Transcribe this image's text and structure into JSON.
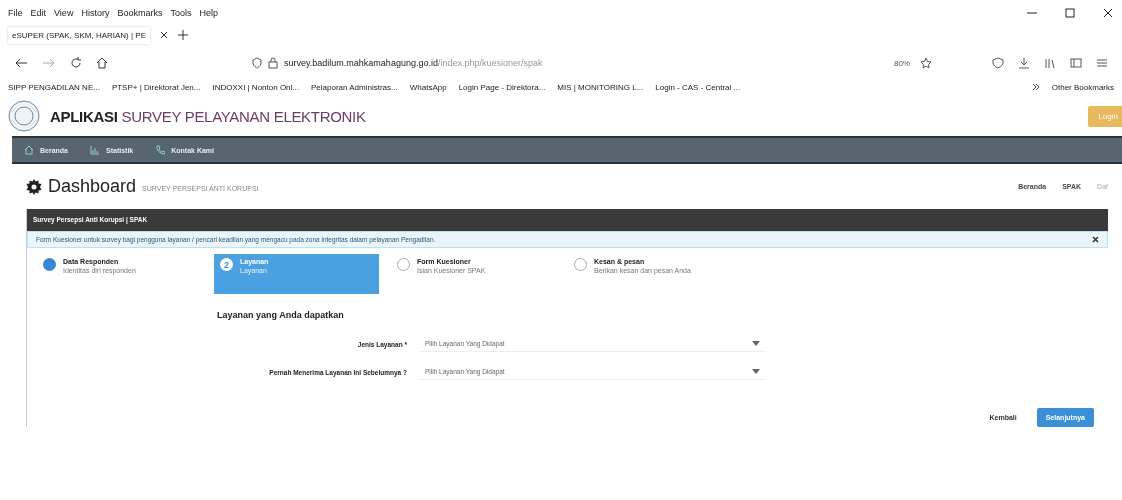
{
  "browser": {
    "menu": [
      "File",
      "Edit",
      "View",
      "History",
      "Bookmarks",
      "Tools",
      "Help"
    ],
    "tabs": [
      {
        "label": "eSUPER (SPAK, SKM, HARIAN) | PE",
        "selected": true
      }
    ],
    "url": {
      "host": "survey.badilum.mahkamahagung.go.id",
      "path": "/index.php/kuesioner/spak"
    },
    "zoom": "80%",
    "bookmarks": [
      "SIPP PENGADILAN NE...",
      "PTSP+ | Direktorat Jen...",
      "INDOXXI | Nonton Onl...",
      "Pelaporan Administras...",
      "WhatsApp",
      "Login Page - Direktora...",
      "MIS | MONITORING L...",
      "Login - CAS - Central ..."
    ],
    "other_bookmarks": "Other Bookmarks"
  },
  "header": {
    "title_bold": "APLIKASI",
    "title": "SURVEY PELAYANAN ELEKTRONIK",
    "login": "Login"
  },
  "nav": [
    {
      "label": "Beranda",
      "kind": "home"
    },
    {
      "label": "Statistik",
      "kind": "chart"
    },
    {
      "label": "Kontak Kami",
      "kind": "phone"
    }
  ],
  "page": {
    "title": "Dashboard",
    "subtitle": "SURVEY PERSEPSI ANTI KORUPSI",
    "breadcrumb": [
      "Beranda",
      "SPAK",
      "Daf"
    ]
  },
  "panel": {
    "title": "Survey Persepsi Anti Korupsi | SPAK",
    "alert": "Form Kuesioner untuk survey bagi pengguna layanan / pencari keadilan yang mengacu pada zona integritas dalam pelayanan Pengadilan.",
    "steps": [
      {
        "title": "Data Responden",
        "sub": "Identitas diri responden",
        "done": true,
        "selected": false
      },
      {
        "title": "Layanan",
        "sub": "Layanan",
        "done": false,
        "selected": true,
        "number": "2"
      },
      {
        "title": "Form Kuesioner",
        "sub": "Isian Kuesioner SPAK",
        "done": false,
        "selected": false
      },
      {
        "title": "Kesan & pesan",
        "sub": "Berikan kesan dan pesan Anda",
        "done": false,
        "selected": false
      }
    ],
    "section": "Layanan yang Anda dapatkan",
    "fields": [
      {
        "label": "Jenis Layanan *",
        "value": "Pilih Layanan Yang Didapat"
      },
      {
        "label": "Pernah Menerima Layanan Ini Sebelumnya ?",
        "value": "Pilih Layanan Yang Didapat"
      }
    ],
    "buttons": {
      "back": "Kembali",
      "next": "Selanjutnya"
    }
  }
}
